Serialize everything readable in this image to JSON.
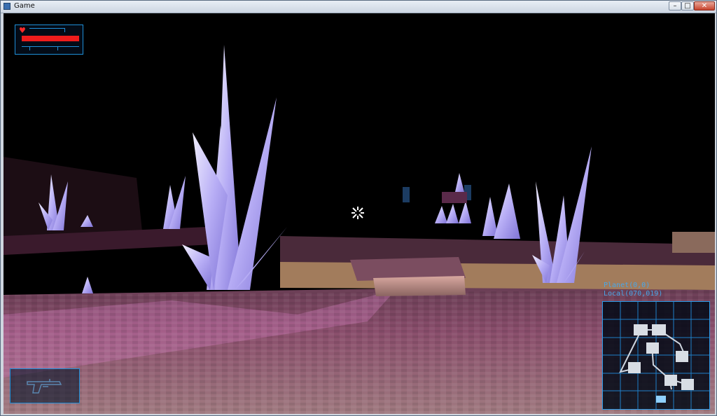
{
  "window": {
    "title": "Game",
    "controls": {
      "minimize": "–",
      "maximize": "□",
      "close": "✕"
    }
  },
  "hud": {
    "health": {
      "icon": "heart-icon",
      "level_percent": 100,
      "bar_color": "#ee1c1c"
    },
    "crosshair_icon": "crosshair-icon",
    "weapon": {
      "icon": "pistol-icon"
    },
    "coordinates": {
      "planet": "Planet(0,0)",
      "local": "Local(070,019)"
    },
    "minimap": {
      "grid": [
        6,
        6
      ]
    }
  },
  "colors": {
    "hud_accent": "#1f8fd8",
    "crystal": "#b9b1ff",
    "floor": "#8a5a70"
  }
}
